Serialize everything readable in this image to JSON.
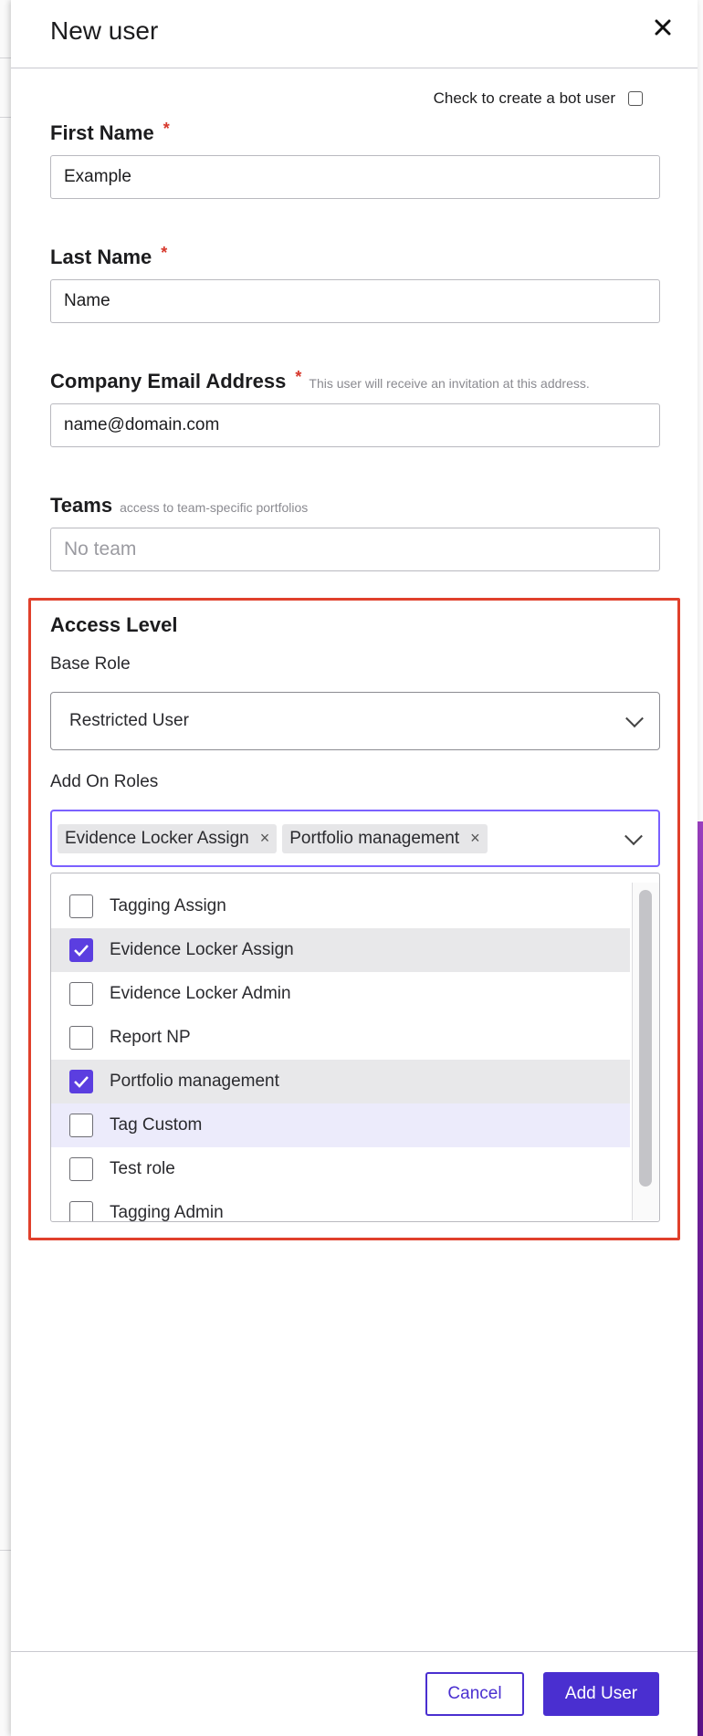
{
  "drawer": {
    "title": "New user",
    "close_icon": "close-icon"
  },
  "bot": {
    "label": "Check to create a bot user",
    "checked": false
  },
  "fields": {
    "first_name": {
      "label": "First Name",
      "required": "*",
      "value": "Example"
    },
    "last_name": {
      "label": "Last Name",
      "required": "*",
      "value": "Name"
    },
    "email": {
      "label": "Company Email Address",
      "required": "*",
      "hint": "This user will receive an invitation at this address.",
      "value": "name@domain.com"
    },
    "teams": {
      "label": "Teams",
      "hint": "access to team-specific portfolios",
      "placeholder": "No team"
    }
  },
  "access": {
    "title": "Access Level",
    "base_role_label": "Base Role",
    "base_role_value": "Restricted User",
    "add_on_label": "Add On Roles",
    "selected_chips": [
      {
        "label": "Evidence Locker Assign",
        "remove": "×"
      },
      {
        "label": "Portfolio management",
        "remove": "×"
      }
    ],
    "options": [
      {
        "label": "Tagging Assign",
        "checked": false
      },
      {
        "label": "Evidence Locker Assign",
        "checked": true
      },
      {
        "label": "Evidence Locker Admin",
        "checked": false
      },
      {
        "label": "Report NP",
        "checked": false
      },
      {
        "label": "Portfolio management",
        "checked": true
      },
      {
        "label": "Tag Custom",
        "checked": false,
        "hovered": true
      },
      {
        "label": "Test role",
        "checked": false
      },
      {
        "label": "Tagging Admin",
        "checked": false
      }
    ]
  },
  "footer": {
    "cancel_label": "Cancel",
    "add_label": "Add User"
  },
  "colors": {
    "accent": "#4a2fd0",
    "checkbox_on": "#5b3ee0",
    "required": "#d7372b",
    "highlight_box": "#e0402c",
    "focus_border": "#7b61ff"
  }
}
